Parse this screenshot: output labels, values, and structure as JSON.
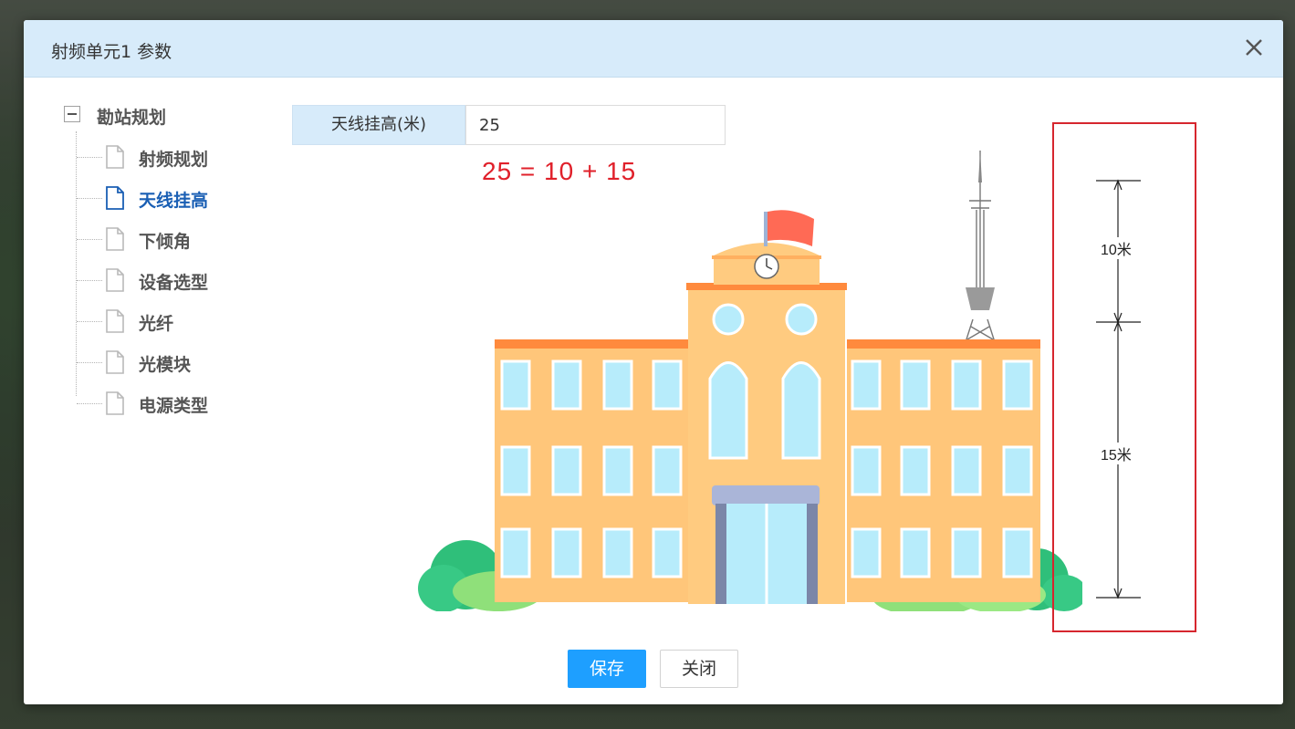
{
  "dialog": {
    "title": "射频单元1 参数",
    "save_label": "保存",
    "close_label": "关闭"
  },
  "tree": {
    "root_label": "勘站规划",
    "items": [
      {
        "label": "射频规划",
        "active": false
      },
      {
        "label": "天线挂高",
        "active": true
      },
      {
        "label": "下倾角",
        "active": false
      },
      {
        "label": "设备选型",
        "active": false
      },
      {
        "label": "光纤",
        "active": false
      },
      {
        "label": "光模块",
        "active": false
      },
      {
        "label": "电源类型",
        "active": false
      }
    ]
  },
  "field": {
    "label": "天线挂高(米)",
    "value": "25"
  },
  "formula": "25 = 10 + 15",
  "scale": {
    "upper_label": "10米",
    "lower_label": "15米"
  },
  "colors": {
    "header_bg": "#d7ebfa",
    "primary": "#1e9fff",
    "highlight_red": "#d6262e",
    "active_tree": "#1a5fb4"
  }
}
